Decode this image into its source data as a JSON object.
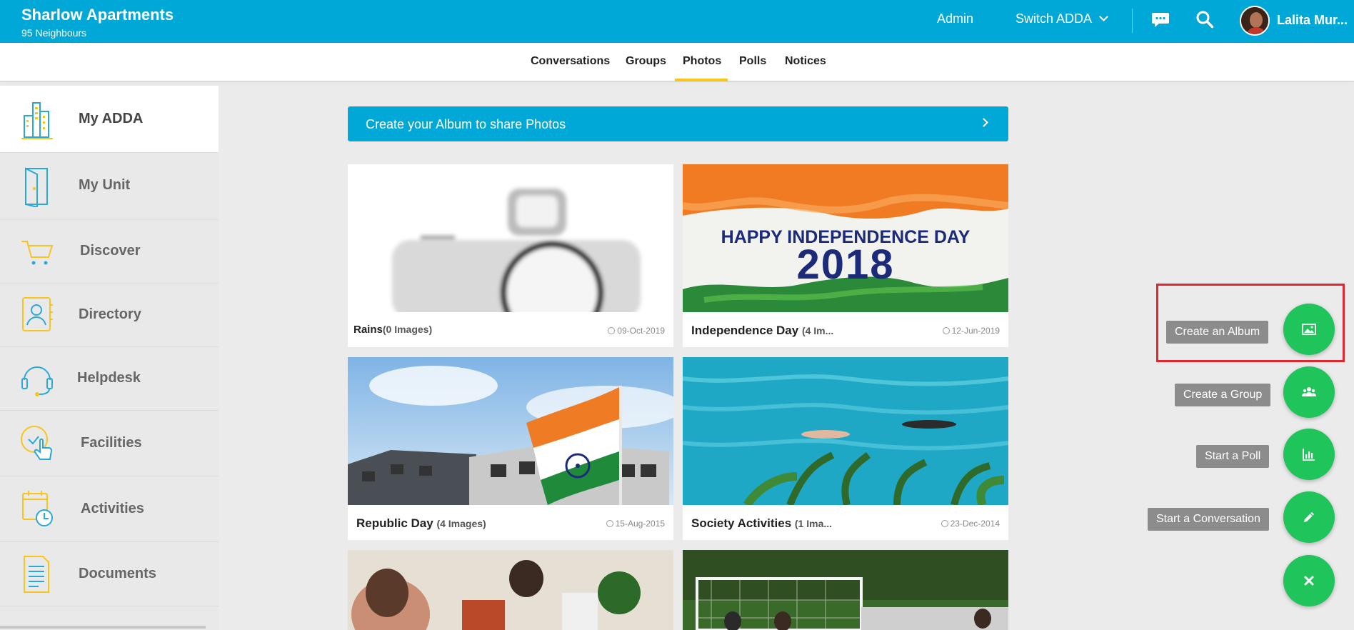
{
  "header": {
    "title": "Sharlow Apartments",
    "subtitle": "95 Neighbours",
    "admin_label": "Admin",
    "switch_label": "Switch ADDA",
    "user_name": "Lalita Mur..."
  },
  "tabs": [
    {
      "label": "Conversations"
    },
    {
      "label": "Groups"
    },
    {
      "label": "Photos",
      "active": true
    },
    {
      "label": "Polls"
    },
    {
      "label": "Notices"
    }
  ],
  "sidebar": {
    "items": [
      {
        "label": "My ADDA",
        "icon": "building-icon",
        "active": true
      },
      {
        "label": "My Unit",
        "icon": "door-icon"
      },
      {
        "label": "Discover",
        "icon": "cart-icon"
      },
      {
        "label": "Directory",
        "icon": "contact-book-icon"
      },
      {
        "label": "Helpdesk",
        "icon": "headset-icon"
      },
      {
        "label": "Facilities",
        "icon": "hand-tap-icon"
      },
      {
        "label": "Activities",
        "icon": "calendar-clock-icon"
      },
      {
        "label": "Documents",
        "icon": "document-icon"
      }
    ]
  },
  "main": {
    "create_banner": "Create your Album to share Photos",
    "albums": [
      {
        "title": "Rains",
        "count": "(0 Images)",
        "date": "09-Oct-2019"
      },
      {
        "title": "Independence Day",
        "count": "(4 Im...",
        "date": "12-Jun-2019",
        "image_text_1": "HAPPY INDEPENDENCE DAY",
        "image_text_2": "2018"
      },
      {
        "title": "Republic Day",
        "count": "(4 Images)",
        "date": "15-Aug-2015"
      },
      {
        "title": "Society Activities",
        "count": "(1 Ima...",
        "date": "23-Dec-2014"
      }
    ]
  },
  "fab_menu": [
    {
      "label": "Create an Album",
      "icon": "image-icon"
    },
    {
      "label": "Create a Group",
      "icon": "group-icon"
    },
    {
      "label": "Start a Poll",
      "icon": "bar-chart-icon"
    },
    {
      "label": "Start a Conversation",
      "icon": "pencil-icon"
    },
    {
      "label": "",
      "icon": "close-icon"
    }
  ],
  "colors": {
    "brand": "#00a8d8",
    "accent": "#f7c51e",
    "fab": "#1fc45a",
    "highlight": "#e3262d"
  }
}
